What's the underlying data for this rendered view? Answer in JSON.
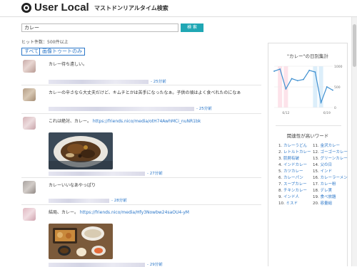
{
  "header": {
    "logo_text": "User Local",
    "subtitle": "マストドンリアルタイム検索"
  },
  "search": {
    "value": "カレー",
    "button": "検 索"
  },
  "hits": "ヒット件数：500件以上",
  "filters": {
    "all": "すべて",
    "images": "画像トゥートのみ"
  },
  "posts": [
    {
      "text": "カレー待ち遠しい。",
      "link": "",
      "time": "- 25分前"
    },
    {
      "text": "カレーの辛さなら大丈夫だけど、キムチとかは苦手になったなぁ。子供の頃はよく食べれたのになぁ",
      "link": "",
      "time": "- 25分前"
    },
    {
      "text": "これは絶対、カレー。",
      "link": "https://friends.nico/media/otH74AwhMCi_nuNR1bk",
      "time": "- 27分前"
    },
    {
      "text": "カレーいいなあやっぱり",
      "link": "",
      "time": "- 28分前"
    },
    {
      "text": "結局、カレー。",
      "link": "https://friends.nico/media/Hfy3Nowbw24saOU4-yM",
      "time": "- 29分前"
    }
  ],
  "chart": {
    "title": "\"カレー\"の日別集計",
    "y_ticks": [
      "1000",
      "500",
      "0"
    ],
    "x_ticks": [
      "6/12",
      "6/19"
    ]
  },
  "chart_data": {
    "type": "line",
    "x": [
      "6/10",
      "6/11",
      "6/12",
      "6/13",
      "6/14",
      "6/15",
      "6/16",
      "6/17",
      "6/18",
      "6/19",
      "6/20"
    ],
    "values": [
      880,
      930,
      450,
      700,
      650,
      680,
      900,
      860,
      120,
      500,
      420
    ],
    "ylim": [
      0,
      1000
    ]
  },
  "related": {
    "title": "関連性が高いワード",
    "left": [
      {
        "n": "1.",
        "w": "カレーうどん"
      },
      {
        "n": "2.",
        "w": "レトルトカレー"
      },
      {
        "n": "3.",
        "w": "肌勢有破"
      },
      {
        "n": "4.",
        "w": "インドカレー"
      },
      {
        "n": "5.",
        "w": "カツカレー"
      },
      {
        "n": "6.",
        "w": "カレーパン"
      },
      {
        "n": "7.",
        "w": "スープカレー"
      },
      {
        "n": "8.",
        "w": "チキンカレー"
      },
      {
        "n": "9.",
        "w": "インド人"
      },
      {
        "n": "10.",
        "w": "ミスド"
      }
    ],
    "right": [
      {
        "n": "11.",
        "w": "金沢カレー"
      },
      {
        "n": "12.",
        "w": "ゴーゴーカレー"
      },
      {
        "n": "13.",
        "w": "グリーンカレー"
      },
      {
        "n": "14.",
        "w": "父の日"
      },
      {
        "n": "15.",
        "w": "インド"
      },
      {
        "n": "16.",
        "w": "カレーラーメン"
      },
      {
        "n": "17.",
        "w": "カレー粉"
      },
      {
        "n": "18.",
        "w": "デレ実"
      },
      {
        "n": "19.",
        "w": "食べ放題"
      },
      {
        "n": "20.",
        "w": "容量組"
      }
    ]
  }
}
